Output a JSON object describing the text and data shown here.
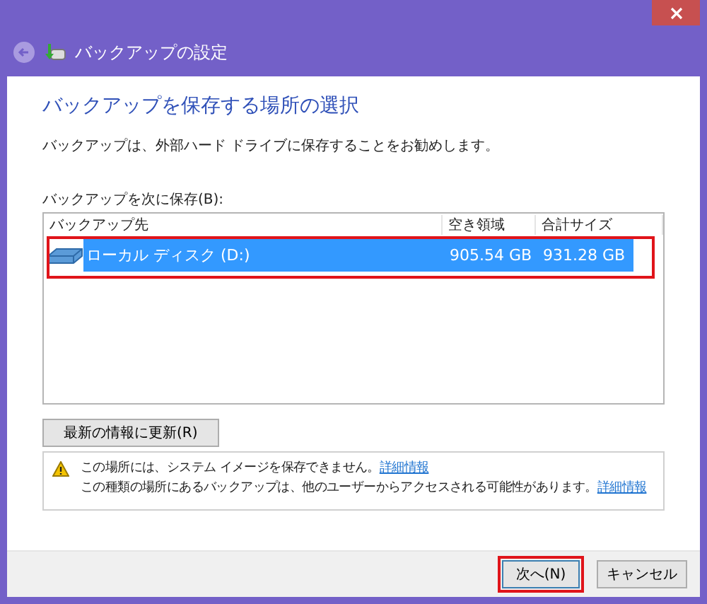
{
  "window": {
    "title": "バックアップの設定"
  },
  "heading": "バックアップを保存する場所の選択",
  "description": "バックアップは、外部ハード ドライブに保存することをお勧めします。",
  "list_label": "バックアップを次に保存(B):",
  "table": {
    "columns": [
      "バックアップ先",
      "空き領域",
      "合計サイズ"
    ],
    "rows": [
      {
        "name": "ローカル ディスク (D:)",
        "free": "905.54 GB",
        "total": "931.28 GB",
        "selected": true
      }
    ]
  },
  "refresh_button": "最新の情報に更新(R)",
  "warnings": [
    {
      "text": "この場所には、システム イメージを保存できません。",
      "link": "詳細情報"
    },
    {
      "text": "この種類の場所にあるバックアップは、他のユーザーからアクセスされる可能性があります。",
      "link": "詳細情報"
    }
  ],
  "buttons": [
    {
      "label": "次へ(N)",
      "kind": "primary"
    },
    {
      "label": "キャンセル",
      "kind": "normal"
    }
  ]
}
